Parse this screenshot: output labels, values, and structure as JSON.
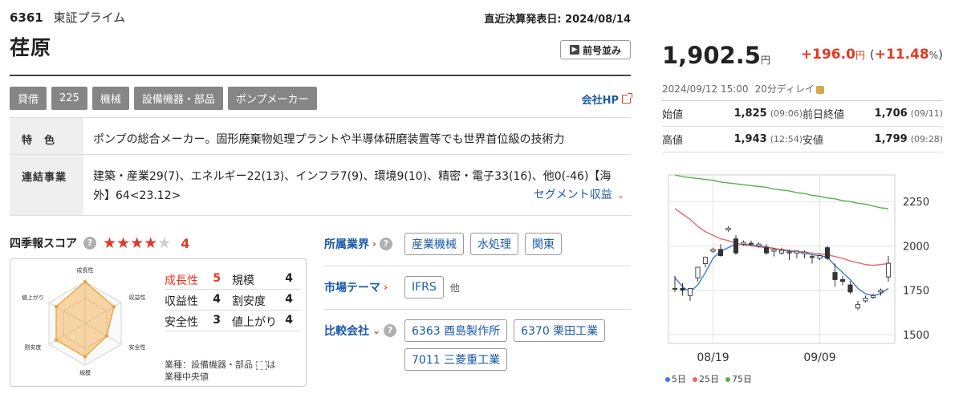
{
  "header": {
    "code": "6361",
    "market": "東証プライム",
    "decl_label": "直近決算発表日:",
    "decl_date": "2024/08/14",
    "company_name": "荏原",
    "prev_button": "前号並み"
  },
  "tags": [
    "貸借",
    "225",
    "機械",
    "設備機器・部品",
    "ポンプメーカー"
  ],
  "company_hp": "会社HP",
  "info": {
    "feature_label": "特　色",
    "feature_text": "ポンプの総合メーカー。固形廃棄物処理プラントや半導体研磨装置等でも世界首位級の技術力",
    "segment_label": "連結事業",
    "segment_text": "建築・産業29(7)、エネルギー22(13)、インフラ7(9)、環境9(10)、精密・電子33(16)、他0(-46)【海外】64<23.12>",
    "segment_link": "セグメント収益"
  },
  "score": {
    "title": "四季報スコア",
    "total": "4",
    "stars_filled": 4,
    "items": [
      {
        "label": "成長性",
        "value": "5",
        "highlight": true
      },
      {
        "label": "規模",
        "value": "4"
      },
      {
        "label": "収益性",
        "value": "4"
      },
      {
        "label": "割安度",
        "value": "4"
      },
      {
        "label": "安全性",
        "value": "3"
      },
      {
        "label": "値上がり",
        "value": "4"
      }
    ],
    "radar_labels": [
      "成長性",
      "収益性",
      "安全性",
      "規模",
      "割安度",
      "値上がり"
    ],
    "note_line1": "業種：設備機器・部品",
    "note_suffix": "は",
    "note_line2": "業種中央値"
  },
  "classification": {
    "industry_label": "所属業界",
    "industry_tags": [
      "産業機械",
      "水処理",
      "関東"
    ],
    "theme_label": "市場テーマ",
    "theme_tags": [
      "IFRS"
    ],
    "theme_other": "他",
    "compare_label": "比較会社",
    "compare_tags": [
      "6363 酉島製作所",
      "6370 栗田工業",
      "7011 三菱重工業"
    ]
  },
  "quote": {
    "price": "1,902.5",
    "price_unit": "円",
    "change": "+196.0",
    "change_unit": "円",
    "change_pct": "+11.48",
    "pct_unit": "%",
    "datetime": "2024/09/12 15:00",
    "delay": "20分ディレイ",
    "open_label": "始値",
    "open": "1,825",
    "open_time": "(09:06)",
    "prev_close_label": "前日終値",
    "prev_close": "1,706",
    "prev_close_date": "(09/11)",
    "high_label": "高値",
    "high": "1,943",
    "high_time": "(12:54)",
    "low_label": "安値",
    "low": "1,799",
    "low_time": "(09:28)"
  },
  "chart_data": {
    "type": "candlestick",
    "x_ticks": [
      "08/19",
      "09/09"
    ],
    "y_ticks": [
      1500,
      1750,
      2000,
      2250
    ],
    "ylim": [
      1450,
      2400
    ],
    "candles": [
      {
        "o": 1760,
        "h": 1830,
        "l": 1740,
        "c": 1760
      },
      {
        "o": 1760,
        "h": 1790,
        "l": 1720,
        "c": 1750
      },
      {
        "o": 1720,
        "h": 1760,
        "l": 1690,
        "c": 1760
      },
      {
        "o": 1820,
        "h": 1850,
        "l": 1800,
        "c": 1880
      },
      {
        "o": 1900,
        "h": 1940,
        "l": 1880,
        "c": 1935
      },
      {
        "o": 1970,
        "h": 1990,
        "l": 1960,
        "c": 1980
      },
      {
        "o": 1980,
        "h": 2010,
        "l": 1940,
        "c": 1945
      },
      {
        "o": 2090,
        "h": 2110,
        "l": 2080,
        "c": 2100
      },
      {
        "o": 2040,
        "h": 2060,
        "l": 1950,
        "c": 1960
      },
      {
        "o": 2010,
        "h": 2030,
        "l": 2000,
        "c": 2020
      },
      {
        "o": 2015,
        "h": 2030,
        "l": 2000,
        "c": 2010
      },
      {
        "o": 2000,
        "h": 2020,
        "l": 1990,
        "c": 2010
      },
      {
        "o": 1990,
        "h": 2010,
        "l": 1950,
        "c": 1960
      },
      {
        "o": 1970,
        "h": 1990,
        "l": 1940,
        "c": 1980
      },
      {
        "o": 1960,
        "h": 1990,
        "l": 1950,
        "c": 1975
      },
      {
        "o": 1960,
        "h": 1980,
        "l": 1920,
        "c": 1965
      },
      {
        "o": 1960,
        "h": 1975,
        "l": 1930,
        "c": 1970
      },
      {
        "o": 1955,
        "h": 1975,
        "l": 1930,
        "c": 1965
      },
      {
        "o": 1940,
        "h": 1950,
        "l": 1900,
        "c": 1935
      },
      {
        "o": 1930,
        "h": 1950,
        "l": 1920,
        "c": 1945
      },
      {
        "o": 1990,
        "h": 2000,
        "l": 1920,
        "c": 1930
      },
      {
        "o": 1850,
        "h": 1900,
        "l": 1770,
        "c": 1810
      },
      {
        "o": 1810,
        "h": 1830,
        "l": 1780,
        "c": 1800
      },
      {
        "o": 1780,
        "h": 1800,
        "l": 1730,
        "c": 1740
      },
      {
        "o": 1650,
        "h": 1690,
        "l": 1640,
        "c": 1670
      },
      {
        "o": 1690,
        "h": 1720,
        "l": 1680,
        "c": 1705
      },
      {
        "o": 1710,
        "h": 1730,
        "l": 1700,
        "c": 1720
      },
      {
        "o": 1740,
        "h": 1760,
        "l": 1720,
        "c": 1750
      },
      {
        "o": 1825,
        "h": 1943,
        "l": 1799,
        "c": 1902
      }
    ],
    "series": [
      {
        "name": "5日",
        "color": "#3a7bd5",
        "values": [
          1820,
          1770,
          1740,
          1780,
          1850,
          1930,
          1970,
          1990,
          2010,
          2010,
          2005,
          2000,
          1995,
          1985,
          1975,
          1970,
          1965,
          1960,
          1950,
          1945,
          1935,
          1890,
          1850,
          1810,
          1760,
          1730,
          1720,
          1730,
          1760
        ]
      },
      {
        "name": "25日",
        "color": "#e66a6a",
        "values": [
          2210,
          2180,
          2150,
          2110,
          2080,
          2060,
          2040,
          2030,
          2015,
          2005,
          2000,
          1995,
          1990,
          1985,
          1980,
          1975,
          1970,
          1965,
          1960,
          1955,
          1950,
          1940,
          1930,
          1915,
          1905,
          1895,
          1890,
          1895,
          1900
        ]
      },
      {
        "name": "75日",
        "color": "#55b14a",
        "values": [
          2400,
          2390,
          2385,
          2380,
          2375,
          2370,
          2360,
          2355,
          2350,
          2345,
          2340,
          2335,
          2330,
          2320,
          2315,
          2310,
          2300,
          2295,
          2285,
          2280,
          2270,
          2265,
          2255,
          2250,
          2240,
          2235,
          2225,
          2215,
          2210
        ]
      }
    ],
    "legend": [
      "5日",
      "25日",
      "75日"
    ]
  }
}
